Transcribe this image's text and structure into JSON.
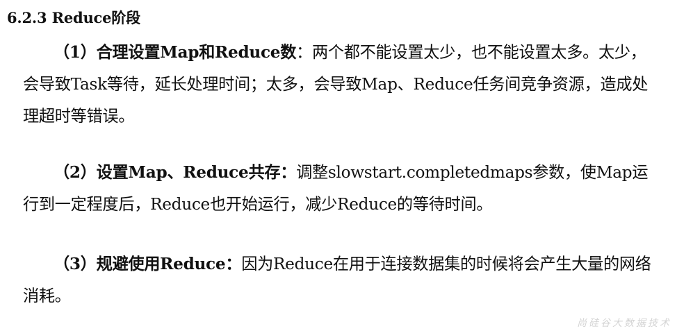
{
  "section": {
    "heading": "6.2.3 Reduce阶段"
  },
  "paragraphs": [
    {
      "lead": "（1）合理设置Map和Reduce数",
      "body": "：两个都不能设置太少，也不能设置太多。太少，会导致Task等待，延长处理时间；太多，会导致Map、Reduce任务间竞争资源，造成处理超时等错误。"
    },
    {
      "lead": "（2）设置Map、Reduce共存：",
      "body": "调整slowstart.completedmaps参数，使Map运行到一定程度后，Reduce也开始运行，减少Reduce的等待时间。"
    },
    {
      "lead": "（3）规避使用Reduce：",
      "body": "因为Reduce在用于连接数据集的时候将会产生大量的网络消耗。"
    }
  ],
  "watermark": "尚硅谷大数据技术"
}
